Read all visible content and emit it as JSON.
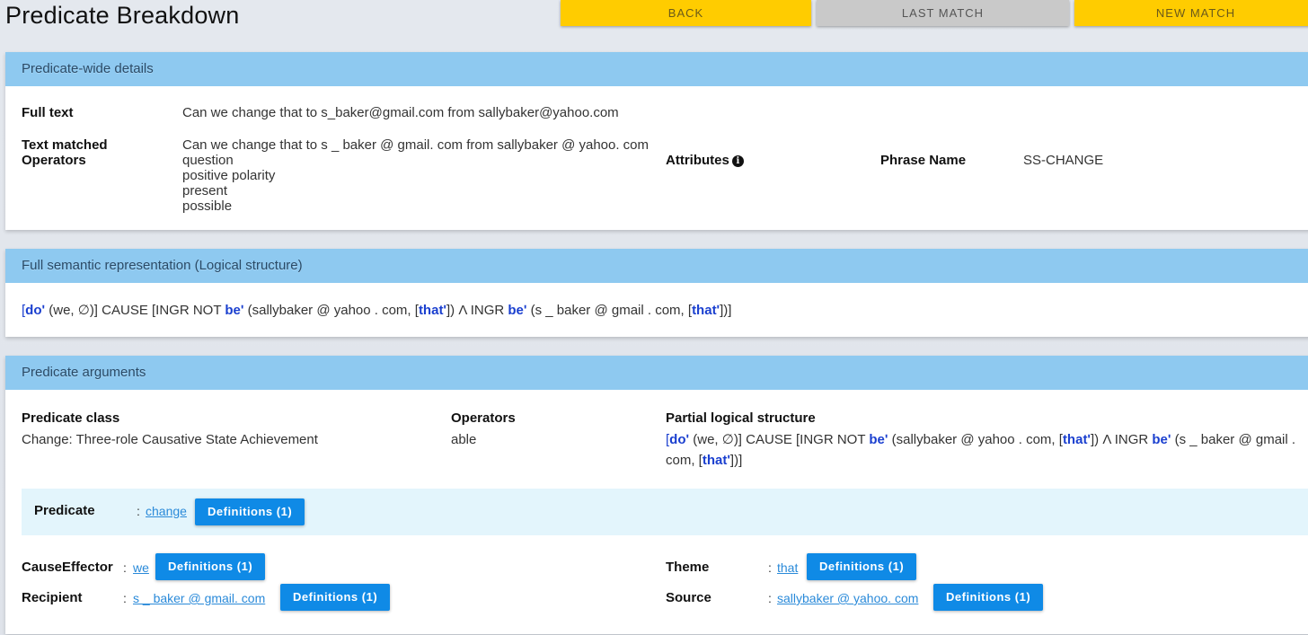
{
  "page": {
    "title": "Predicate Breakdown"
  },
  "nav": {
    "back": "BACK",
    "last_match": "LAST MATCH",
    "new_match": "NEW MATCH"
  },
  "predicate_wide": {
    "header": "Predicate-wide details",
    "full_text_label": "Full text",
    "full_text": "Can we change that to s_baker@gmail.com from sallybaker@yahoo.com",
    "text_matched_label": "Text matched",
    "text_matched": "Can we change that to s _ baker @ gmail. com from sallybaker @ yahoo. com",
    "operators_label": "Operators",
    "operators": [
      "question",
      "positive polarity",
      "present",
      "possible"
    ],
    "attributes_label": "Attributes",
    "attributes_icon": "info-icon",
    "phrase_name_label": "Phrase Name",
    "phrase_name": "SS-CHANGE"
  },
  "semantic": {
    "header": "Full semantic representation (Logical structure)",
    "t1": "[",
    "do": "doʹ",
    "t2": " (we, ∅)] CAUSE [INGR NOT ",
    "be1": "beʹ",
    "t3": " (sallybaker @ yahoo . com, [",
    "that1": "thatʹ",
    "t4": "]) Λ INGR ",
    "be2": "beʹ",
    "t5": " (s _ baker @ gmail . com, [",
    "that2": "thatʹ",
    "t6": "])]"
  },
  "arguments": {
    "header": "Predicate arguments",
    "class_label": "Predicate class",
    "class_value": "Change:  Three-role Causative State Achievement",
    "operators_label": "Operators",
    "operators_value": "able",
    "partial_label": "Partial logical structure",
    "predicate_label": "Predicate",
    "predicate_value": "change",
    "definitions_label": "Definitions (1)",
    "cause_label": "CauseEffector",
    "cause_value": "we",
    "recipient_label": "Recipient",
    "recipient_value": "s _ baker @ gmail. com",
    "theme_label": "Theme",
    "theme_value": "that",
    "source_label": "Source",
    "source_value": "sallybaker @ yahoo. com",
    "colon": ":"
  },
  "colors": {
    "header_bg": "#8ec9f0",
    "accent_yellow": "#ffcc00",
    "button_blue": "#0f8ae6",
    "logic_blue": "#1a3fcf",
    "link_blue": "#2a8ad9"
  }
}
